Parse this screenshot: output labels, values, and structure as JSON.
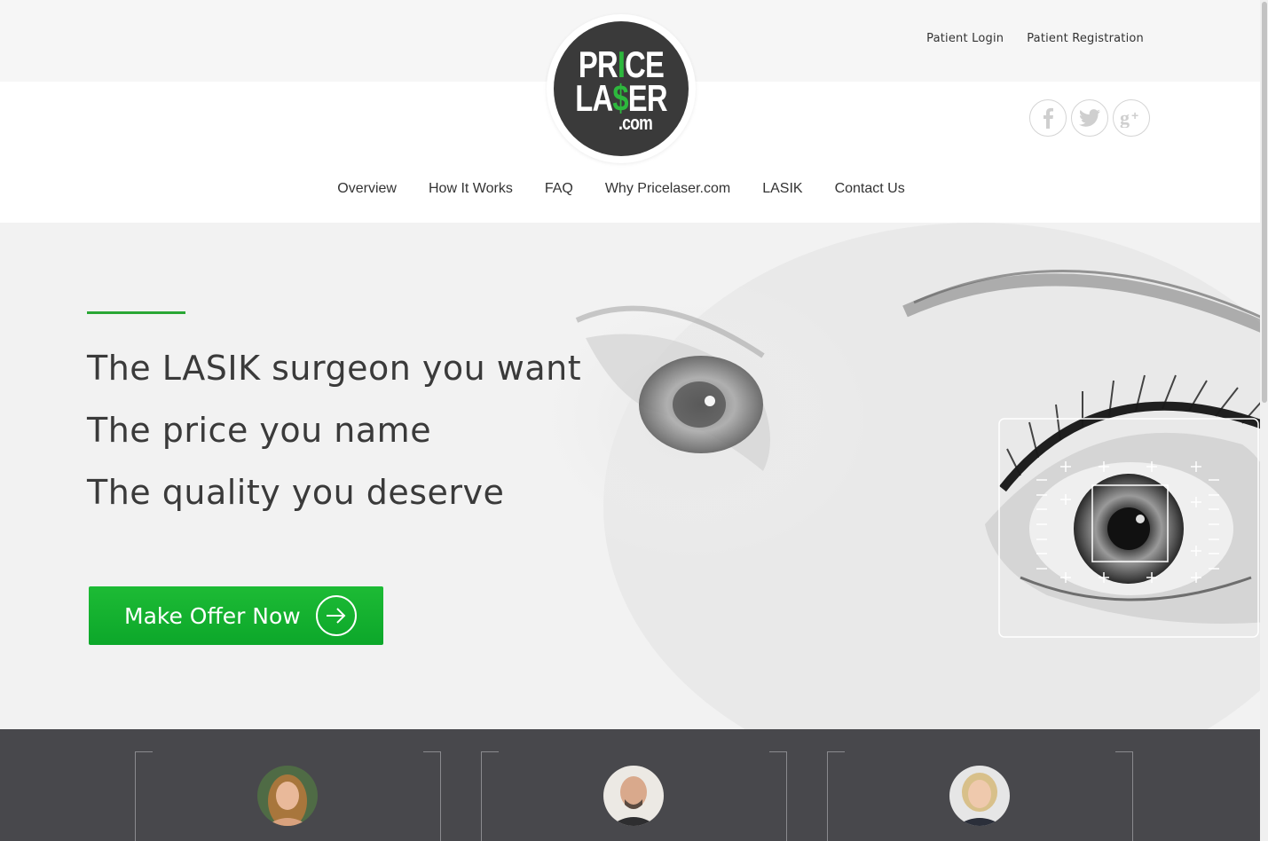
{
  "header": {
    "top_links": [
      "Patient Login",
      "Patient Registration"
    ],
    "logo": {
      "line1_a": "PR",
      "line1_b": "I",
      "line1_c": "CE",
      "line2_a": "LA",
      "line2_b": "$",
      "line2_c": "ER",
      "line3": ".com"
    },
    "social": [
      "facebook-icon",
      "twitter-icon",
      "google-plus-icon"
    ],
    "nav": [
      "Overview",
      "How It Works",
      "FAQ",
      "Why Pricelaser.com",
      "LASIK",
      "Contact Us"
    ]
  },
  "hero": {
    "line1": "The LASIK surgeon you want",
    "line2": "The price you name",
    "line3": "The quality you deserve",
    "cta_label": "Make Offer Now"
  },
  "colors": {
    "accent_green": "#0faa2c",
    "logo_bg": "#3a3a3a",
    "dark_band": "#48484c"
  }
}
